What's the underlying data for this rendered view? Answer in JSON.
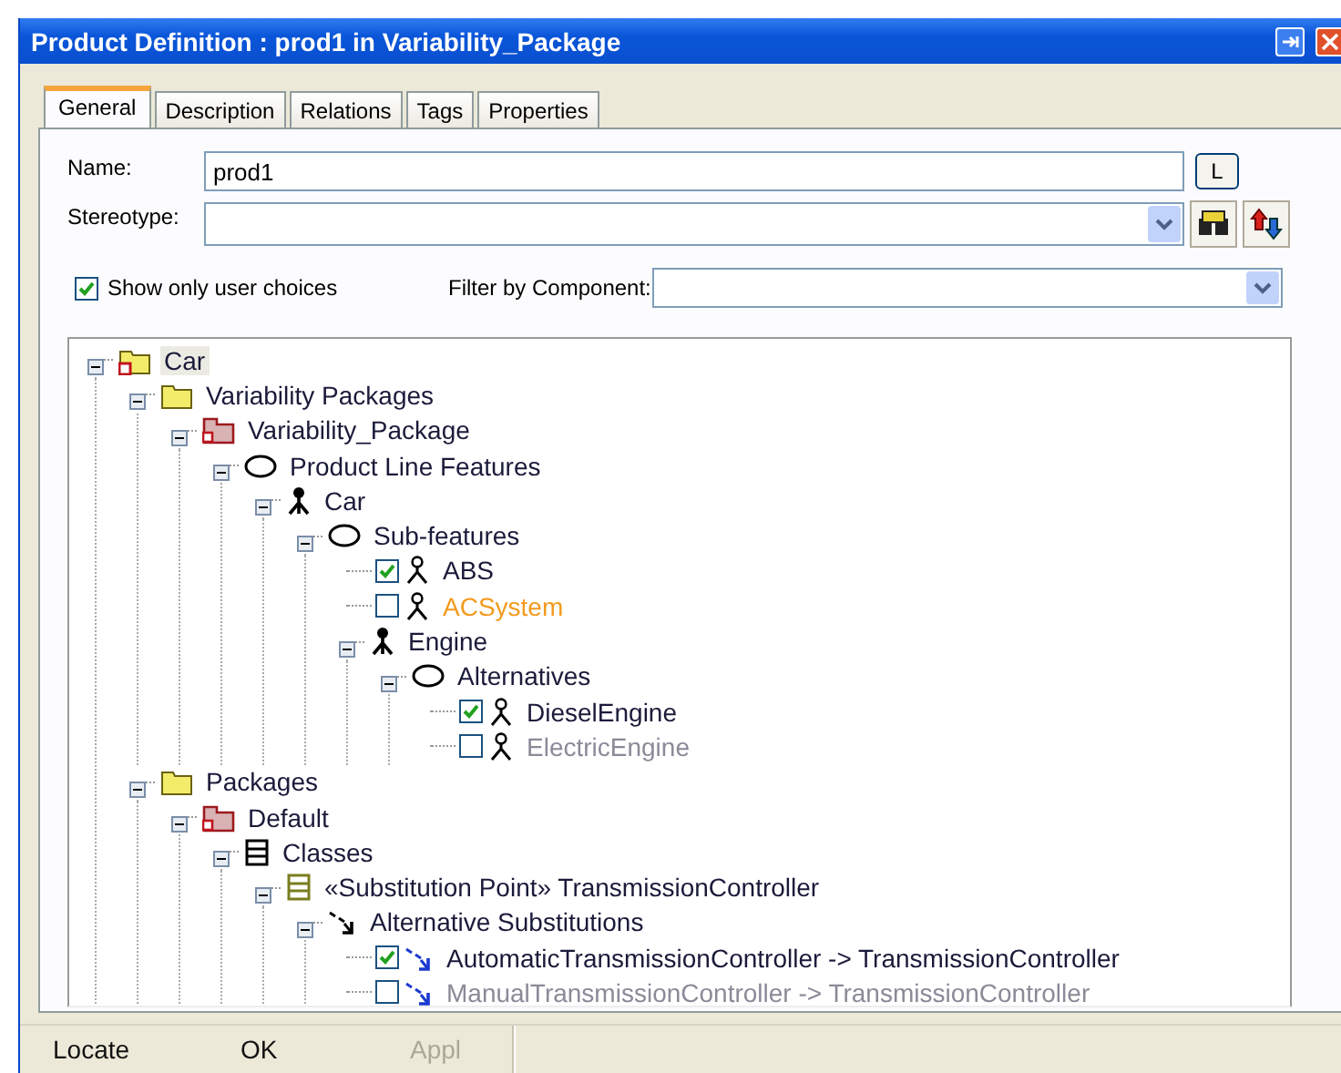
{
  "window": {
    "title": "Product Definition : prod1 in Variability_Package"
  },
  "tabs": [
    {
      "label": "General",
      "selected": true
    },
    {
      "label": "Description",
      "selected": false
    },
    {
      "label": "Relations",
      "selected": false
    },
    {
      "label": "Tags",
      "selected": false
    },
    {
      "label": "Properties",
      "selected": false
    }
  ],
  "form": {
    "name_label": "Name:",
    "name_value": "prod1",
    "name_button": "L",
    "stereotype_label": "Stereotype:",
    "user_choices": {
      "label": "Show only user choices",
      "checked": true
    },
    "filter_label": "Filter by Component:"
  },
  "tree": {
    "nodes": [
      {
        "label": "Car",
        "kind": "model",
        "selected": true,
        "expanded": true,
        "children": [
          {
            "label": "Variability Packages",
            "kind": "folder",
            "selected": false,
            "expanded": true,
            "children": [
              {
                "label": "Variability_Package",
                "kind": "package",
                "selected": false,
                "expanded": true,
                "children": [
                  {
                    "label": "Product Line Features",
                    "kind": "group",
                    "selected": false,
                    "expanded": true,
                    "children": [
                      {
                        "label": "Car",
                        "kind": "feature",
                        "selected": false,
                        "expanded": true,
                        "children": [
                          {
                            "label": "Sub-features",
                            "kind": "group",
                            "selected": false,
                            "expanded": true,
                            "children": [
                              {
                                "label": "ABS",
                                "kind": "optional-feature",
                                "selected": false,
                                "checked": true,
                                "color": "#1a1a3a"
                              },
                              {
                                "label": "ACSystem",
                                "kind": "optional-feature",
                                "selected": false,
                                "checked": false,
                                "color": "#f29a1e"
                              },
                              {
                                "label": "Engine",
                                "kind": "feature",
                                "selected": false,
                                "expanded": true,
                                "children": [
                                  {
                                    "label": "Alternatives",
                                    "kind": "group",
                                    "selected": false,
                                    "expanded": true,
                                    "children": [
                                      {
                                        "label": "DieselEngine",
                                        "kind": "optional-feature",
                                        "selected": false,
                                        "checked": true,
                                        "color": "#1a1a3a"
                                      },
                                      {
                                        "label": "ElectricEngine",
                                        "kind": "optional-feature",
                                        "selected": false,
                                        "checked": false,
                                        "color": "#8a8a98"
                                      }
                                    ]
                                  }
                                ]
                              }
                            ]
                          }
                        ]
                      }
                    ]
                  }
                ]
              }
            ]
          },
          {
            "label": "Packages",
            "kind": "folder",
            "selected": false,
            "expanded": true,
            "children": [
              {
                "label": "Default",
                "kind": "package",
                "selected": false,
                "expanded": true,
                "children": [
                  {
                    "label": "Classes",
                    "kind": "classes",
                    "selected": false,
                    "expanded": true,
                    "children": [
                      {
                        "label": "«Substitution Point» TransmissionController",
                        "kind": "class",
                        "selected": false,
                        "expanded": true,
                        "children": [
                          {
                            "label": "Alternative Substitutions",
                            "kind": "substitutions",
                            "selected": false,
                            "expanded": true,
                            "children": [
                              {
                                "label": "AutomaticTransmissionController -> TransmissionController",
                                "kind": "substitution",
                                "selected": false,
                                "checked": true,
                                "color": "#1a1a3a"
                              },
                              {
                                "label": "ManualTransmissionController -> TransmissionController",
                                "kind": "substitution",
                                "selected": false,
                                "checked": false,
                                "color": "#8a8a98"
                              }
                            ]
                          }
                        ]
                      }
                    ]
                  }
                ]
              }
            ]
          }
        ]
      }
    ]
  },
  "buttons": [
    {
      "label": "Locate",
      "disabled": false
    },
    {
      "label": "OK",
      "disabled": false
    },
    {
      "label": "Appl",
      "disabled": true
    }
  ]
}
